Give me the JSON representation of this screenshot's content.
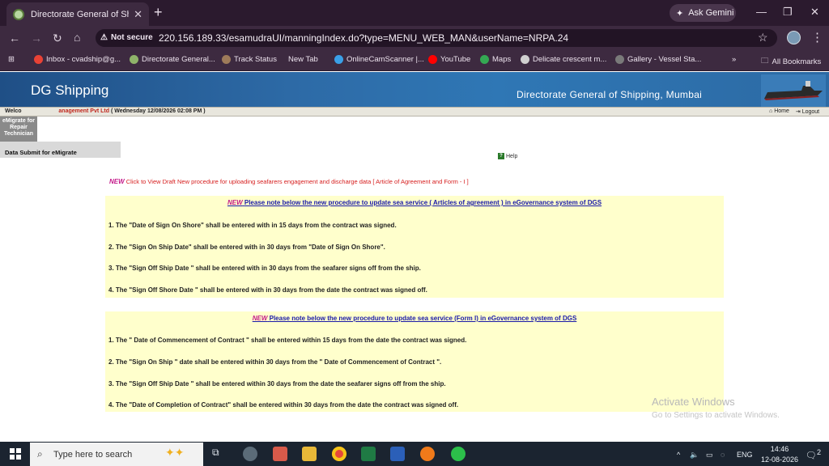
{
  "browser": {
    "tab_title": "Directorate General of Shipping",
    "new_tab_symbol": "+",
    "ask_gemini": "Ask Gemini",
    "security_label": "Not secure",
    "url": "220.156.189.33/esamudraUI/manningIndex.do?type=MENU_WEB_MAN&userName=NRPA.24",
    "bookmarks": [
      {
        "label": "Inbox - cvadship@g...",
        "color": "#e94235"
      },
      {
        "label": "Directorate General...",
        "color": "#8fb36a"
      },
      {
        "label": "Track Status",
        "color": "#9e7b5a"
      },
      {
        "label": "New Tab",
        "color": ""
      },
      {
        "label": "OnlineCamScanner |...",
        "color": "#3aa0e8"
      },
      {
        "label": "YouTube",
        "color": "#ff0000"
      },
      {
        "label": "Maps",
        "color": "#34a853"
      },
      {
        "label": "Delicate crescent m...",
        "color": "#cfcfcf"
      },
      {
        "label": "Gallery - Vessel Sta...",
        "color": "#7a7a7a"
      }
    ],
    "all_bookmarks": "All Bookmarks"
  },
  "site": {
    "title": "DG Shipping",
    "org_full": "Directorate General of Shipping, Mumbai",
    "welcome_prefix": "Welco",
    "welcome_org": "anagement Pvt Ltd",
    "welcome_date": "( Wednesday 12/08/2026 02:08 PM )",
    "home_link": "Home",
    "logout_link": "Logout",
    "side_box": "eMigrate for Repair Technician",
    "side_link": "Data Submit for eMigrate",
    "help": "Help",
    "new_tag": "NEW",
    "draft_link": "Click to View Draft New procedure for uploading seafarers engagement and discharge data [ Article of Agreement and Form - I ]"
  },
  "panel1": {
    "heading": "Please note below the new procedure to update sea service ( Articles of agreement ) in eGovernance system of DGS",
    "rules": [
      "1. The \"Date of Sign On Shore\" shall be entered with in 15 days from the contract was signed.",
      "2. The \"Sign On Ship Date\" shall be entered with in 30 days from \"Date of Sign On Shore\".",
      "3. The \"Sign Off Ship Date \" shall be entered with in 30 days from the seafarer signs off from the ship.",
      "4. The \"Sign Off Shore Date \" shall be entered with in 30 days from the date the contract was signed off."
    ]
  },
  "panel2": {
    "heading": "Please note below the new procedure to update sea service (Form I) in eGovernance system of DGS",
    "rules": [
      "1. The \" Date of Commencement of Contract \" shall be entered within 15 days from the date the contract was signed.",
      "2. The \"Sign On Ship \" date shall be entered within 30 days from the \" Date of Commencement of Contract \".",
      "3. The \"Sign Off Ship Date \" shall be entered within 30 days from the date the seafarer signs off from the ship.",
      "4. The \"Date of Completion of Contract\" shall be entered within 30 days from the date the contract was signed off."
    ]
  },
  "watermark": {
    "line1": "Activate Windows",
    "line2": "Go to Settings to activate Windows."
  },
  "taskbar": {
    "search_placeholder": "Type here to search",
    "lang": "ENG",
    "time": "14:46",
    "date": "12-08-2026",
    "notifications": "2"
  }
}
